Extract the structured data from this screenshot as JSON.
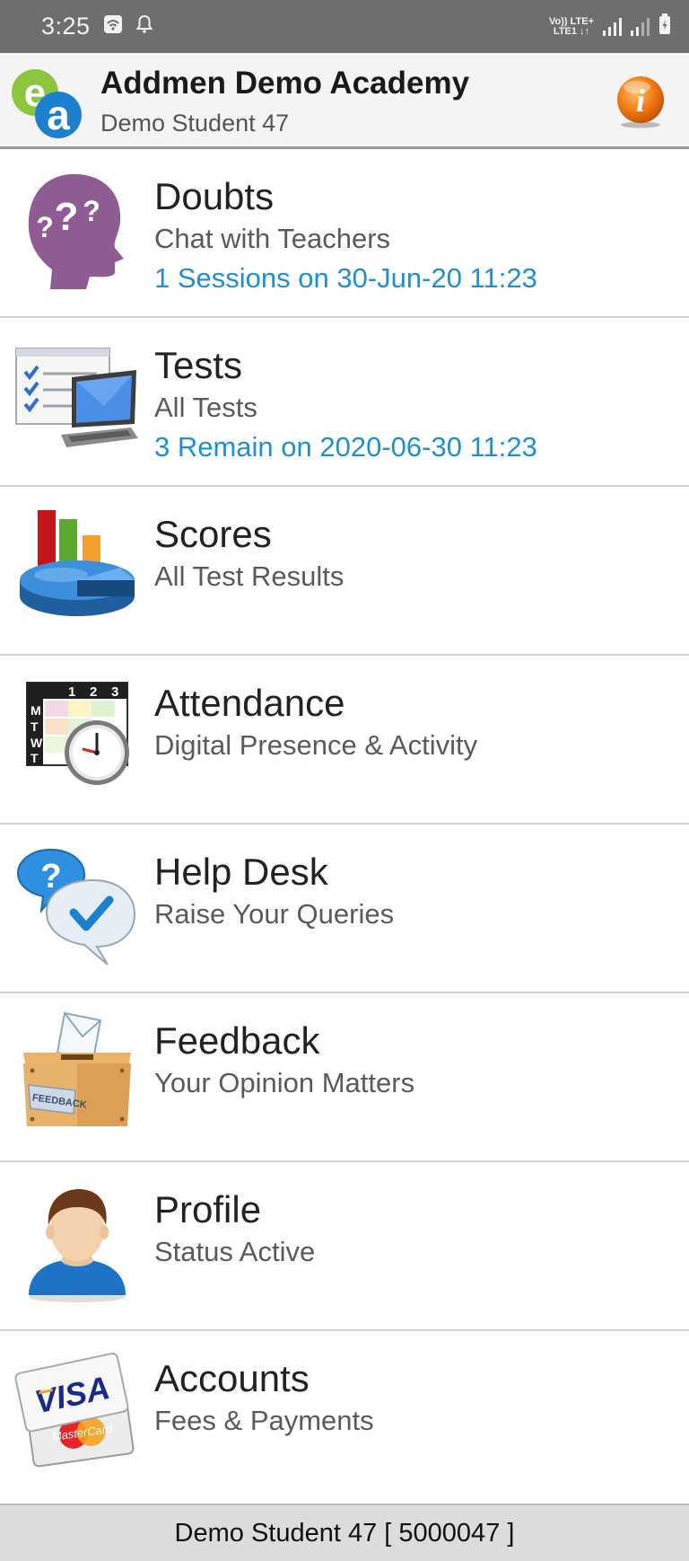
{
  "status_bar": {
    "time": "3:25",
    "network_top": "Vo)) LTE+",
    "network_bottom": "LTE1 ↓↑",
    "icons": [
      "wifi-icon",
      "notification-bell-icon",
      "signal-icon",
      "battery-icon"
    ]
  },
  "header": {
    "title": "Addmen Demo Academy",
    "subtitle": "Demo Student 47",
    "logo_icon": "ea-logo-icon",
    "info_icon": "info-icon",
    "accent_color": "#f07a14"
  },
  "menu": [
    {
      "id": "doubts",
      "title": "Doubts",
      "subtitle": "Chat with Teachers",
      "meta": "1 Sessions on 30-Jun-20 11:23",
      "icon": "question-head-icon"
    },
    {
      "id": "tests",
      "title": "Tests",
      "subtitle": "All Tests",
      "meta": "3 Remain on 2020-06-30 11:23",
      "icon": "laptop-checklist-icon"
    },
    {
      "id": "scores",
      "title": "Scores",
      "subtitle": "All Test Results",
      "meta": "",
      "icon": "pie-bar-chart-icon"
    },
    {
      "id": "attendance",
      "title": "Attendance",
      "subtitle": "Digital Presence & Activity",
      "meta": "",
      "icon": "calendar-clock-icon"
    },
    {
      "id": "helpdesk",
      "title": "Help Desk",
      "subtitle": "Raise Your Queries",
      "meta": "",
      "icon": "chat-bubbles-icon"
    },
    {
      "id": "feedback",
      "title": "Feedback",
      "subtitle": "Your Opinion Matters",
      "meta": "",
      "icon": "feedback-box-icon"
    },
    {
      "id": "profile",
      "title": "Profile",
      "subtitle": "Status Active",
      "meta": "",
      "icon": "user-avatar-icon"
    },
    {
      "id": "accounts",
      "title": "Accounts",
      "subtitle": "Fees & Payments",
      "meta": "",
      "icon": "credit-cards-icon"
    }
  ],
  "icon_text": {
    "calendar_days": [
      "1",
      "2",
      "3"
    ],
    "calendar_weekdays": [
      "M",
      "T",
      "W",
      "T"
    ],
    "feedback_label": "FEEDBACK",
    "visa_label": "VISA",
    "mastercard_label": "MasterCard"
  },
  "footer": {
    "text": "Demo Student 47 [ 5000047 ]"
  },
  "colors": {
    "link_blue": "#1e8fd6",
    "status_bar_bg": "#6e6e6e",
    "footer_bg": "#dcdcdc"
  }
}
